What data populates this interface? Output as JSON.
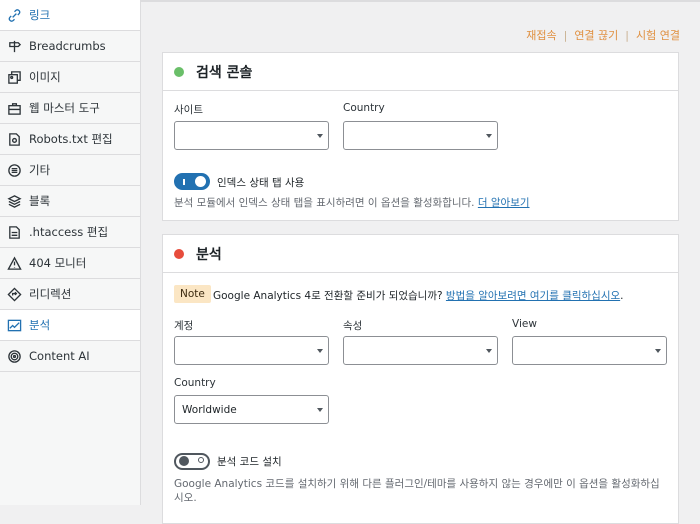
{
  "sidebar": {
    "items": [
      {
        "label": "링크",
        "icon": "link-icon"
      },
      {
        "label": "Breadcrumbs",
        "icon": "signpost-icon"
      },
      {
        "label": "이미지",
        "icon": "images-icon"
      },
      {
        "label": "웹 마스터 도구",
        "icon": "toolbox-icon"
      },
      {
        "label": "Robots.txt 편집",
        "icon": "file-icon"
      },
      {
        "label": "기타",
        "icon": "list-icon"
      },
      {
        "label": "블록",
        "icon": "blocks-icon"
      },
      {
        "label": ".htaccess 편집",
        "icon": "document-icon"
      },
      {
        "label": "404 모니터",
        "icon": "warning-icon"
      },
      {
        "label": "리디렉션",
        "icon": "redirect-icon"
      },
      {
        "label": "분석",
        "icon": "analytics-icon"
      },
      {
        "label": "Content AI",
        "icon": "content-ai-icon"
      }
    ]
  },
  "top_links": {
    "reconnect": "재접속",
    "disconnect": "연결 끊기",
    "test_connection": "시험 연결"
  },
  "search_console": {
    "title": "검색 콘솔",
    "status_color": "#6abf69",
    "site_label": "사이트",
    "site_value": "",
    "country_label": "Country",
    "country_value": "",
    "toggle_label": "인덱스 상태 탭 사용",
    "toggle_on": true,
    "description": "분석 모듈에서 인덱스 상태 탭을 표시하려면 이 옵션을 활성화합니다.",
    "learn_more": "더 알아보기"
  },
  "analytics": {
    "title": "분석",
    "status_color": "#e74c3c",
    "note_badge": "Note",
    "note_text": "Google Analytics 4로 전환할 준비가 되었습니까? ",
    "note_link": "방법을 알아보려면 여기를 클릭하십시오",
    "note_end": ".",
    "account_label": "계정",
    "account_value": "",
    "property_label": "속성",
    "property_value": "",
    "view_label": "View",
    "view_value": "",
    "country_label": "Country",
    "country_value": "Worldwide",
    "toggle_label": "분석 코드 설치",
    "toggle_on": false,
    "description": "Google Analytics 코드를 설치하기 위해 다른 플러그인/테마를 사용하지 않는 경우에만 이 옵션을 활성화하십시오."
  }
}
